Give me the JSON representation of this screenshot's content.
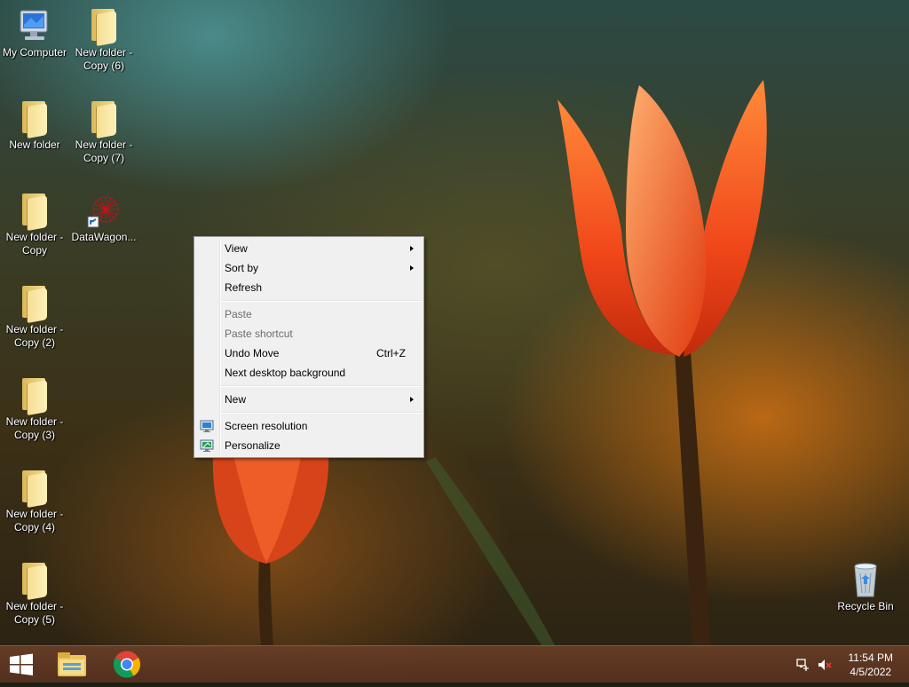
{
  "desktop": {
    "icons": [
      {
        "label": "My Computer",
        "type": "computer"
      },
      {
        "label": "New folder - Copy (6)",
        "type": "folder"
      },
      {
        "label": "New folder",
        "type": "folder"
      },
      {
        "label": "New folder - Copy (7)",
        "type": "folder"
      },
      {
        "label": "New folder - Copy",
        "type": "folder"
      },
      {
        "label": "DataWagon...",
        "type": "shortcut-app"
      },
      {
        "label": "New folder - Copy (2)",
        "type": "folder"
      },
      {
        "label": "New folder - Copy (3)",
        "type": "folder"
      },
      {
        "label": "New folder - Copy (4)",
        "type": "folder"
      },
      {
        "label": "New folder - Copy (5)",
        "type": "folder"
      },
      {
        "label": "Recycle Bin",
        "type": "recycle-bin"
      }
    ]
  },
  "context_menu": {
    "items": [
      {
        "label": "View",
        "submenu": true
      },
      {
        "label": "Sort by",
        "submenu": true
      },
      {
        "label": "Refresh"
      },
      {
        "label": "Paste",
        "disabled": true
      },
      {
        "label": "Paste shortcut",
        "disabled": true
      },
      {
        "label": "Undo Move",
        "shortcut": "Ctrl+Z"
      },
      {
        "label": "Next desktop background"
      },
      {
        "label": "New",
        "submenu": true
      },
      {
        "label": "Screen resolution",
        "icon": "display-icon"
      },
      {
        "label": "Personalize",
        "icon": "personalize-icon"
      }
    ]
  },
  "taskbar": {
    "pinned": [
      "start-button",
      "file-explorer",
      "google-chrome"
    ],
    "tray_icons": [
      "network-icon",
      "volume-muted-icon"
    ],
    "clock": {
      "time": "11:54 PM",
      "date": "4/5/2022"
    }
  },
  "colors": {
    "menu_background": "#f0f0f0",
    "menu_disabled_text": "#6d6d6d",
    "taskbar": "#6a3e28"
  }
}
